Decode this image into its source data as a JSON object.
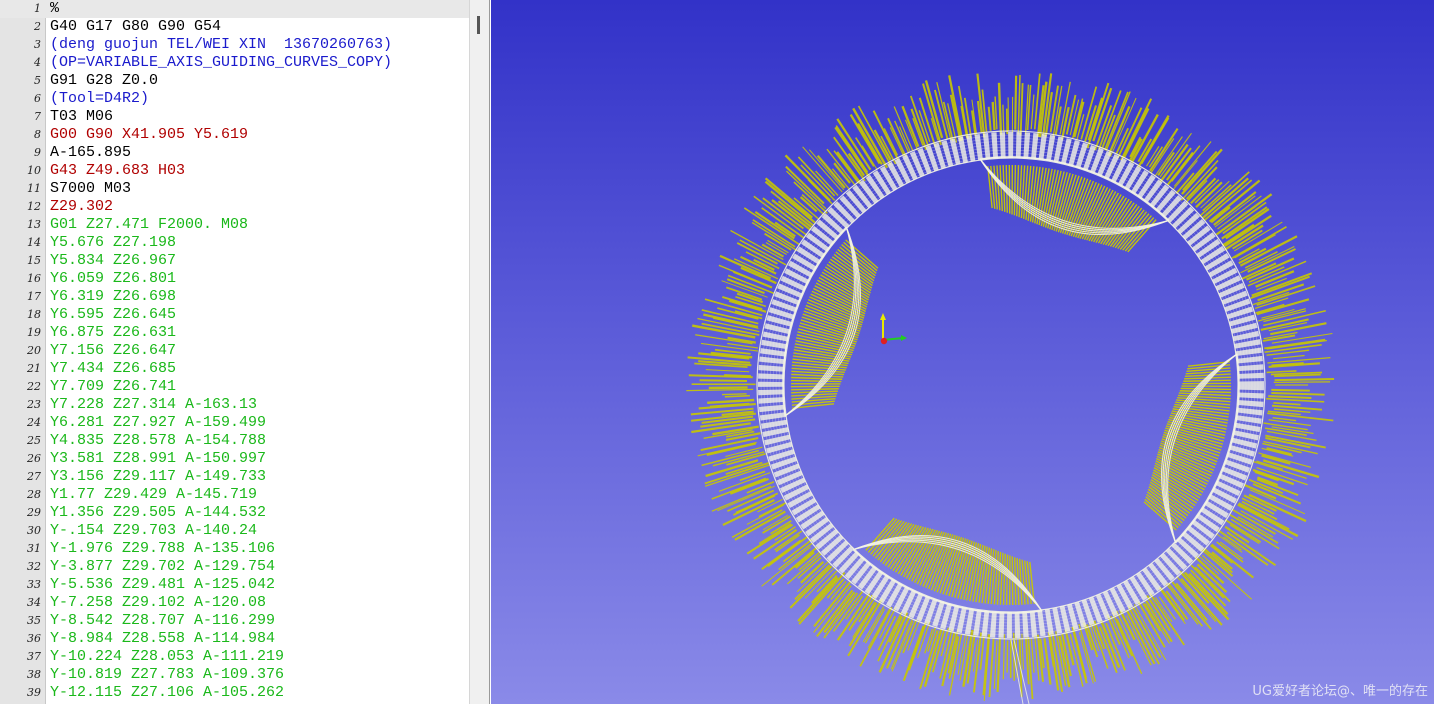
{
  "editor": {
    "lines": [
      {
        "num": "1",
        "text": "%",
        "color": "#000000"
      },
      {
        "num": "2",
        "text": "G40 G17 G80 G90 G54",
        "color": "#000000"
      },
      {
        "num": "3",
        "text": "(deng guojun TEL/WEI XIN  13670260763)",
        "color": "#1a1acc"
      },
      {
        "num": "4",
        "text": "(OP=VARIABLE_AXIS_GUIDING_CURVES_COPY)",
        "color": "#1a1acc"
      },
      {
        "num": "5",
        "text": "G91 G28 Z0.0",
        "color": "#000000"
      },
      {
        "num": "6",
        "text": "(Tool=D4R2)",
        "color": "#1a1acc"
      },
      {
        "num": "7",
        "text": "T03 M06",
        "color": "#000000"
      },
      {
        "num": "8",
        "text": "G00 G90 X41.905 Y5.619",
        "color": "#b00000"
      },
      {
        "num": "9",
        "text": "A-165.895",
        "color": "#000000"
      },
      {
        "num": "10",
        "text": "G43 Z49.683 H03",
        "color": "#b00000"
      },
      {
        "num": "11",
        "text": "S7000 M03",
        "color": "#000000"
      },
      {
        "num": "12",
        "text": "Z29.302",
        "color": "#b00000"
      },
      {
        "num": "13",
        "text": "G01 Z27.471 F2000. M08",
        "color": "#1ab81a"
      },
      {
        "num": "14",
        "text": "Y5.676 Z27.198",
        "color": "#1ab81a"
      },
      {
        "num": "15",
        "text": "Y5.834 Z26.967",
        "color": "#1ab81a"
      },
      {
        "num": "16",
        "text": "Y6.059 Z26.801",
        "color": "#1ab81a"
      },
      {
        "num": "17",
        "text": "Y6.319 Z26.698",
        "color": "#1ab81a"
      },
      {
        "num": "18",
        "text": "Y6.595 Z26.645",
        "color": "#1ab81a"
      },
      {
        "num": "19",
        "text": "Y6.875 Z26.631",
        "color": "#1ab81a"
      },
      {
        "num": "20",
        "text": "Y7.156 Z26.647",
        "color": "#1ab81a"
      },
      {
        "num": "21",
        "text": "Y7.434 Z26.685",
        "color": "#1ab81a"
      },
      {
        "num": "22",
        "text": "Y7.709 Z26.741",
        "color": "#1ab81a"
      },
      {
        "num": "23",
        "text": "Y7.228 Z27.314 A-163.13",
        "color": "#1ab81a"
      },
      {
        "num": "24",
        "text": "Y6.281 Z27.927 A-159.499",
        "color": "#1ab81a"
      },
      {
        "num": "25",
        "text": "Y4.835 Z28.578 A-154.788",
        "color": "#1ab81a"
      },
      {
        "num": "26",
        "text": "Y3.581 Z28.991 A-150.997",
        "color": "#1ab81a"
      },
      {
        "num": "27",
        "text": "Y3.156 Z29.117 A-149.733",
        "color": "#1ab81a"
      },
      {
        "num": "28",
        "text": "Y1.77 Z29.429 A-145.719",
        "color": "#1ab81a"
      },
      {
        "num": "29",
        "text": "Y1.356 Z29.505 A-144.532",
        "color": "#1ab81a"
      },
      {
        "num": "30",
        "text": "Y-.154 Z29.703 A-140.24",
        "color": "#1ab81a"
      },
      {
        "num": "31",
        "text": "Y-1.976 Z29.788 A-135.106",
        "color": "#1ab81a"
      },
      {
        "num": "32",
        "text": "Y-3.877 Z29.702 A-129.754",
        "color": "#1ab81a"
      },
      {
        "num": "33",
        "text": "Y-5.536 Z29.481 A-125.042",
        "color": "#1ab81a"
      },
      {
        "num": "34",
        "text": "Y-7.258 Z29.102 A-120.08",
        "color": "#1ab81a"
      },
      {
        "num": "35",
        "text": "Y-8.542 Z28.707 A-116.299",
        "color": "#1ab81a"
      },
      {
        "num": "36",
        "text": "Y-8.984 Z28.558 A-114.984",
        "color": "#1ab81a"
      },
      {
        "num": "37",
        "text": "Y-10.224 Z28.053 A-111.219",
        "color": "#1ab81a"
      },
      {
        "num": "38",
        "text": "Y-10.819 Z27.783 A-109.376",
        "color": "#1ab81a"
      },
      {
        "num": "39",
        "text": "Y-12.115 Z27.106 A-105.262",
        "color": "#1ab81a"
      }
    ]
  },
  "viewport": {
    "watermark": "UG爱好者论坛@、唯一的存在",
    "background_top": "#3232c8",
    "background_bottom": "#8a8ae8",
    "toolpath_color": "#c8c800",
    "part_color": "#f4f4e4"
  },
  "icons": {
    "triad": "axis-triad-icon"
  }
}
